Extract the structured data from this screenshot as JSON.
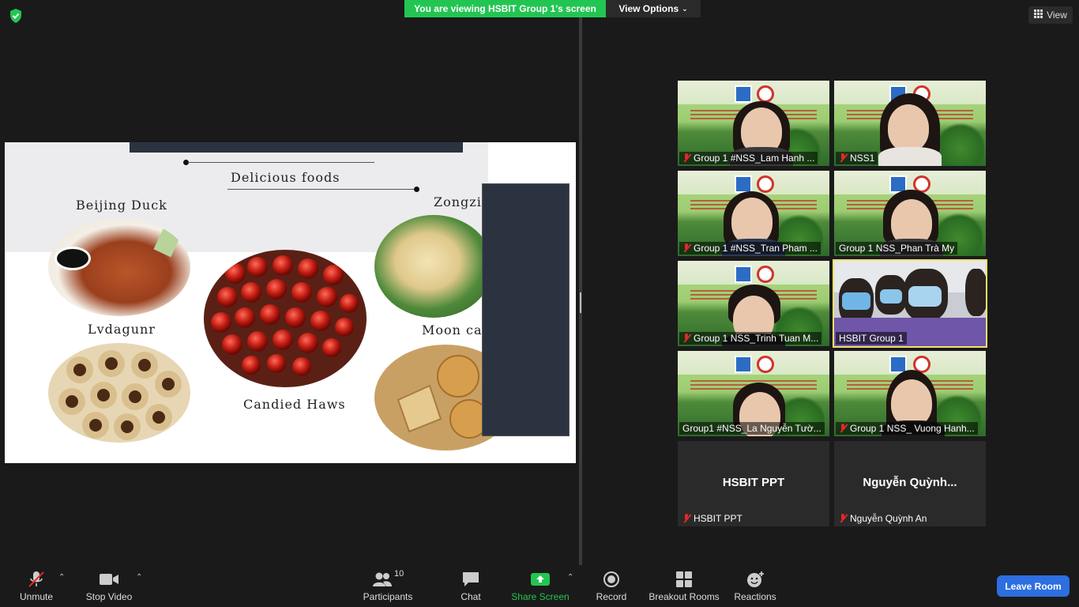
{
  "top": {
    "banner": "You are viewing HSBIT Group 1's screen",
    "view_options": "View Options",
    "view": "View"
  },
  "slide": {
    "heading": "Delicious foods",
    "labels": {
      "beijing_duck": "Beijing Duck",
      "zongzi": "Zongzi",
      "lvdagunr": "Lvdagunr",
      "moon_cake": "Moon cake",
      "candied_haws": "Candied Haws"
    }
  },
  "participants": [
    {
      "name": "Group 1 #NSS_Lam Hanh ...",
      "muted": true
    },
    {
      "name": "NSS1",
      "muted": true
    },
    {
      "name": "Group 1 #NSS_Tran Pham ...",
      "muted": true
    },
    {
      "name": "Group 1 NSS_Phan Trà My",
      "muted": false
    },
    {
      "name": "Group 1 NSS_Trinh Tuan M...",
      "muted": true
    },
    {
      "name": "HSBIT Group 1",
      "muted": false
    },
    {
      "name": "Group1 #NSS_La Nguyễn Tườ...",
      "muted": false
    },
    {
      "name": "Group 1 NSS_ Vuong Hanh...",
      "muted": true
    },
    {
      "name": "HSBIT PPT",
      "muted": true,
      "display_name": "HSBIT PPT"
    },
    {
      "name": "Nguyễn Quỳnh An",
      "muted": true,
      "display_name": "Nguyễn  Quỳnh..."
    }
  ],
  "toolbar": {
    "unmute": "Unmute",
    "stop_video": "Stop Video",
    "participants": "Participants",
    "participants_count": "10",
    "chat": "Chat",
    "share_screen": "Share Screen",
    "record": "Record",
    "breakout_rooms": "Breakout Rooms",
    "reactions": "Reactions",
    "leave_room": "Leave Room"
  },
  "colors": {
    "banner_green": "#23c552",
    "share_green": "#23c552",
    "leave_blue": "#2d6ee0",
    "muted_red": "#e02828",
    "active_speaker": "#f2e16b"
  }
}
